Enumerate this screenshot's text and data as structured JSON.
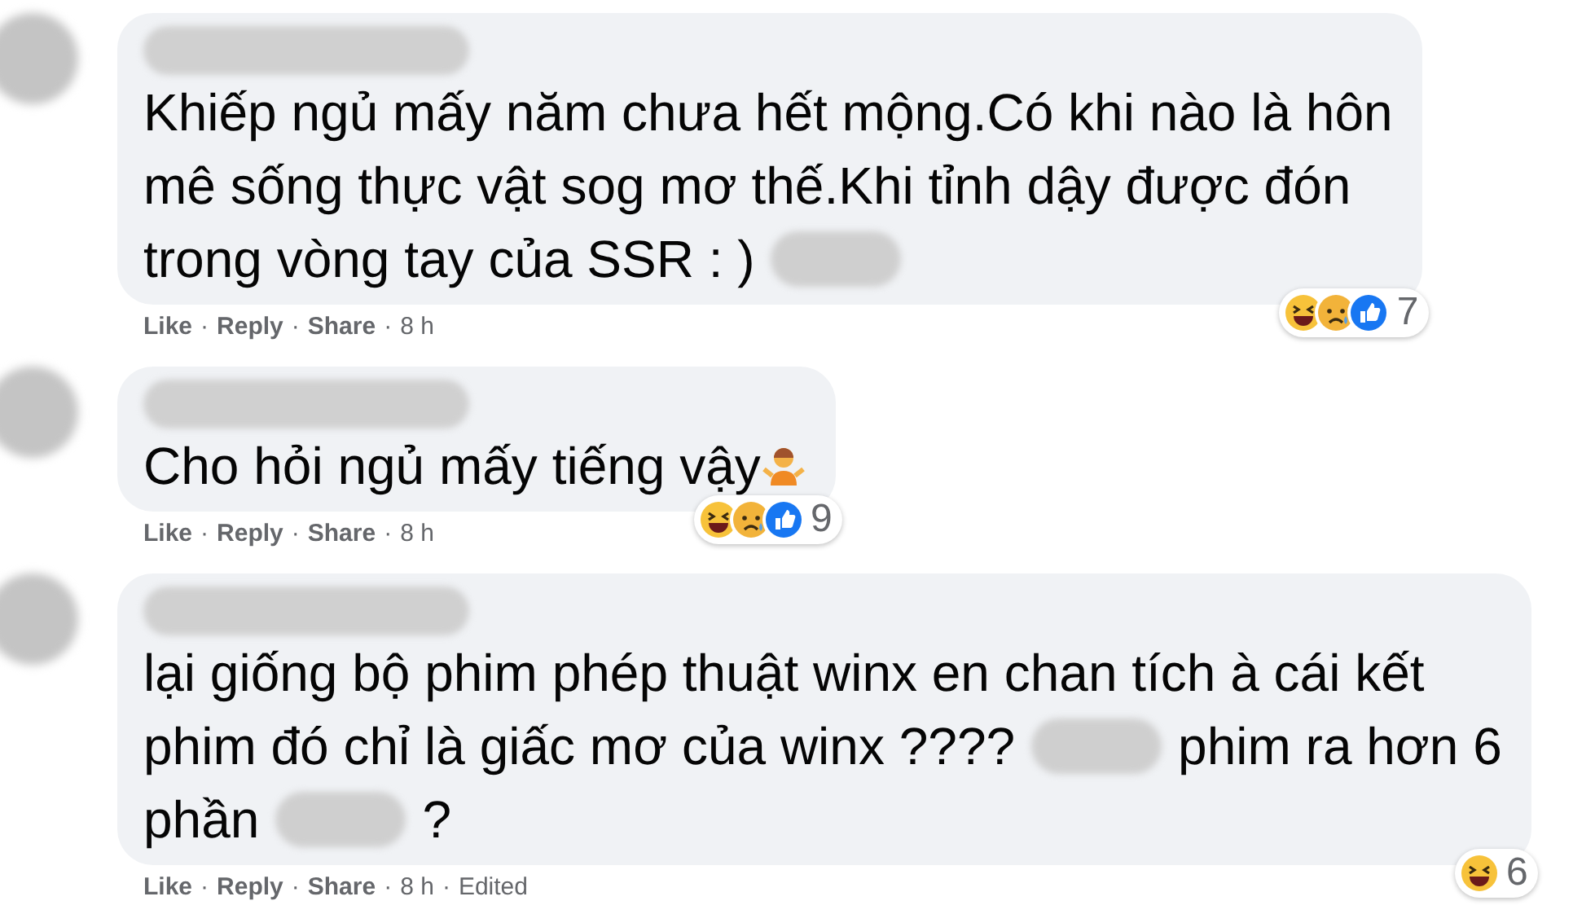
{
  "comments": [
    {
      "lines": [
        [
          {
            "kind": "text",
            "text": "Khiếp ngủ mấy năm chưa hết mộng.Có khi nào là hôn"
          }
        ],
        [
          {
            "kind": "text",
            "text": "mê sống thực vật sog mơ thế.Khi tỉnh dậy được đón"
          }
        ],
        [
          {
            "kind": "text",
            "text": "trong vòng tay của SSR : )"
          },
          {
            "kind": "redacted"
          }
        ]
      ],
      "reactions": {
        "types": [
          {
            "kind": "haha"
          },
          {
            "kind": "sad"
          },
          {
            "kind": "like"
          }
        ],
        "count": "7"
      },
      "actions": [
        "Like",
        "Reply",
        "Share",
        "8 h"
      ],
      "separator": "·"
    },
    {
      "lines": [
        [
          {
            "kind": "text",
            "text": "Cho hỏi ngủ mấy tiếng vậy"
          },
          {
            "kind": "shrug"
          }
        ]
      ],
      "reactions": {
        "types": [
          {
            "kind": "haha"
          },
          {
            "kind": "sad"
          },
          {
            "kind": "like"
          }
        ],
        "count": "9"
      },
      "actions": [
        "Like",
        "Reply",
        "Share",
        "8 h"
      ],
      "separator": "·"
    },
    {
      "lines": [
        [
          {
            "kind": "text",
            "text": "lại giống bộ phim phép thuật winx en chan tích à cái kết"
          }
        ],
        [
          {
            "kind": "text",
            "text": "phim đó chỉ là giấc mơ của winx ????"
          },
          {
            "kind": "redacted"
          },
          {
            "kind": "text",
            "text": "phim ra hơn 6"
          }
        ],
        [
          {
            "kind": "text",
            "text": "phần"
          },
          {
            "kind": "redacted"
          },
          {
            "kind": "text",
            "text": "?"
          }
        ]
      ],
      "reactions": {
        "types": [
          {
            "kind": "haha"
          }
        ],
        "count": "6"
      },
      "actions": [
        "Like",
        "Reply",
        "Share",
        "8 h",
        "Edited"
      ],
      "separator": "·"
    }
  ]
}
